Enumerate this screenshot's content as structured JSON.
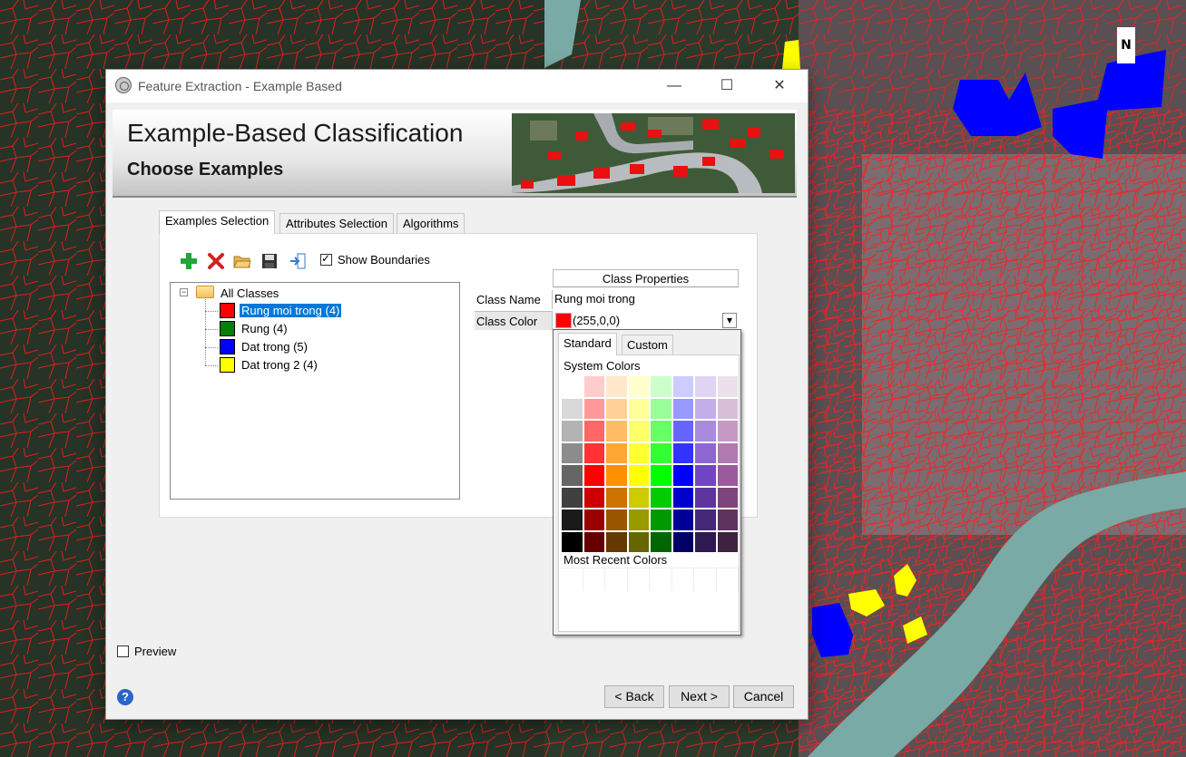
{
  "map": {
    "north_arrow_label": "N",
    "colors": {
      "outline": "#ff1010",
      "river": "#79aaa5",
      "blue": "#0000ff",
      "yellow": "#ffff00"
    }
  },
  "window": {
    "title": "Feature Extraction - Example Based",
    "controls": {
      "minimize": "—",
      "maximize": "☐",
      "close": "✕"
    }
  },
  "banner": {
    "title": "Example-Based Classification",
    "subtitle": "Choose Examples"
  },
  "tabs": [
    {
      "label": "Examples Selection",
      "active": true
    },
    {
      "label": "Attributes Selection",
      "active": false
    },
    {
      "label": "Algorithms",
      "active": false
    }
  ],
  "toolbar": {
    "icons": [
      "add-class-icon",
      "delete-class-icon",
      "open-folder-icon",
      "save-icon",
      "import-icon"
    ],
    "show_boundaries_label": "Show Boundaries",
    "show_boundaries_checked": true
  },
  "tree": {
    "root_label": "All Classes",
    "expander": "−",
    "classes": [
      {
        "label": "Rung moi trong (4)",
        "color": "#ff0000",
        "selected": true
      },
      {
        "label": "Rung (4)",
        "color": "#008000",
        "selected": false
      },
      {
        "label": "Dat trong (5)",
        "color": "#0000ff",
        "selected": false
      },
      {
        "label": "Dat trong 2 (4)",
        "color": "#ffff00",
        "selected": false
      }
    ]
  },
  "class_properties": {
    "header": "Class Properties",
    "name_label": "Class Name",
    "name_value": "Rung moi trong",
    "color_label": "Class Color",
    "color_value": "(255,0,0)",
    "color_swatch": "#ff0000",
    "dropdown_arrow": "▾"
  },
  "color_picker": {
    "tabs": [
      "Standard",
      "Custom"
    ],
    "system_colors_label": "System Colors",
    "most_recent_label": "Most Recent Colors",
    "rows": [
      [
        "#ffffff",
        "#ffcccc",
        "#ffe8cc",
        "#ffffcc",
        "#ccffcc",
        "#ccccff",
        "#e0d4f4",
        "#ece0ec"
      ],
      [
        "#d9d9d9",
        "#ff9999",
        "#ffd199",
        "#ffff99",
        "#99ff99",
        "#9999ff",
        "#c4aeea",
        "#d8bfd8"
      ],
      [
        "#b3b3b3",
        "#ff6666",
        "#ffbb66",
        "#ffff66",
        "#66ff66",
        "#6666ff",
        "#a98add",
        "#c49ac4"
      ],
      [
        "#8c8c8c",
        "#ff3333",
        "#ffa633",
        "#ffff33",
        "#33ff33",
        "#3333ff",
        "#8d66d1",
        "#b07ab0"
      ],
      [
        "#666666",
        "#ff0000",
        "#ff9000",
        "#ffff00",
        "#00ff00",
        "#0000ff",
        "#7245c4",
        "#9b5a9b"
      ],
      [
        "#404040",
        "#cc0000",
        "#cc7300",
        "#cccc00",
        "#00cc00",
        "#0000cc",
        "#5c369e",
        "#7d457d"
      ],
      [
        "#1a1a1a",
        "#990000",
        "#995600",
        "#999900",
        "#009900",
        "#000099",
        "#452878",
        "#5e335e"
      ],
      [
        "#000000",
        "#660000",
        "#663900",
        "#666600",
        "#006600",
        "#000066",
        "#2e1a50",
        "#3f223f"
      ]
    ]
  },
  "preview": {
    "label": "Preview",
    "checked": false
  },
  "help_label": "?",
  "buttons": {
    "back": "< Back",
    "next": "Next >",
    "cancel": "Cancel"
  }
}
